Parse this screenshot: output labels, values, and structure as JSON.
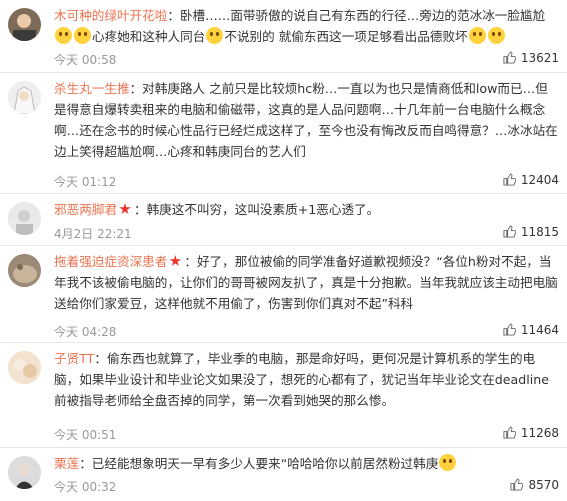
{
  "comments": [
    {
      "user": "木可种的绿叶开花啦",
      "text_a": "：卧槽……面带骄傲的说自己有东西的行径…旁边的范冰冰一脸尴尬",
      "text_b": "心疼她和这种人同台",
      "text_c": "不说别的 就偷东西这一项足够看出品德败坏",
      "time": "今天 00:58",
      "likes": "13621"
    },
    {
      "user": "杀生丸一生推",
      "text_a": "：对韩庚路人 之前只是比较烦hc粉…一直以为也只是情商低和low而已…但是得意自爆转卖租来的电脑和偷磁带，这真的是人品问题啊…十几年前一台电脑什么概念啊…还在念书的时候心性品行已经烂成这样了，至今也没有悔改反而自鸣得意？…冰冰站在边上笑得超尴尬啊…心疼和韩庚同台的艺人们",
      "time": "今天 01:12",
      "likes": "12404"
    },
    {
      "user": "邪恶两脚君",
      "vip": true,
      "text_a": "：韩庚这不叫穷，这叫没素质+1恶心透了。",
      "time": "4月2日 22:21",
      "likes": "11815"
    },
    {
      "user": "拖着强迫症资深患者",
      "vip": true,
      "text_a": "：好了，那位被偷的同学准备好道歉视频没？“各位h粉对不起，当年我不该被偷电脑的，让你们的哥哥被网友扒了，真是十分抱歉。当年我就应该主动把电脑送给你们家爱豆，这样他就不用偷了，伤害到你们真对不起”科科",
      "time": "今天 04:28",
      "likes": "11464"
    },
    {
      "user": "子贤TT",
      "text_a": "：偷东西也就算了，毕业季的电脑，那是命好吗，更何况是计算机系的学生的电脑，如果毕业设计和毕业论文如果没了，想死的心都有了，犹记当年毕业论文在deadline前被指导老师给全盘否掉的同学，第一次看到她哭的那么惨。",
      "time": "今天 00:51",
      "likes": "11268"
    },
    {
      "user": "栗莲",
      "text_a": "：已经能想象明天一早有多少人要来“哈哈哈你以前居然粉过韩庚",
      "time": "今天 00:32",
      "likes": "8570"
    }
  ],
  "icons": {
    "like": "thumbs-up-icon",
    "vip": "red-star-icon",
    "emoji": "face-emoji-icon"
  },
  "colors": {
    "username": "#eb7350",
    "meta": "#999999",
    "text": "#333333",
    "vip": "#e8362a"
  }
}
